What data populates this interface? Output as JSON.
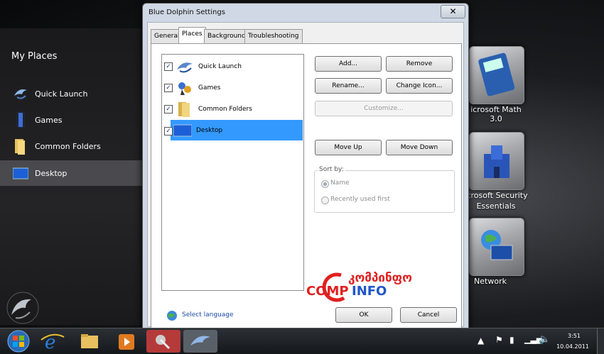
{
  "desktop": {
    "left_panel": {
      "title": "My Places",
      "items": [
        {
          "label": "Quick Launch",
          "icon": "dolphin-icon",
          "selected": false
        },
        {
          "label": "Games",
          "icon": "games-icon",
          "selected": false
        },
        {
          "label": "Common Folders",
          "icon": "folder-icon",
          "selected": false
        },
        {
          "label": "Desktop",
          "icon": "desktop-icon",
          "selected": true
        }
      ]
    },
    "icons": [
      {
        "label": "icrosoft Math 3.0",
        "icon": "calculator-icon"
      },
      {
        "label_line1": "icrosoft Security",
        "label_line2": "Essentials",
        "icon": "castle-icon"
      },
      {
        "label": "Network",
        "icon": "network-icon"
      }
    ]
  },
  "dialog": {
    "title": "Blue Dolphin Settings",
    "close_label": "✕",
    "tabs": [
      {
        "label": "General",
        "active": false
      },
      {
        "label": "Places",
        "active": true
      },
      {
        "label": "Background",
        "active": false
      },
      {
        "label": "Troubleshooting",
        "active": false
      }
    ],
    "places": [
      {
        "label": "Quick Launch",
        "checked": true,
        "selected": false
      },
      {
        "label": "Games",
        "checked": true,
        "selected": false
      },
      {
        "label": "Common Folders",
        "checked": true,
        "selected": false
      },
      {
        "label": "Desktop",
        "checked": true,
        "selected": true
      }
    ],
    "buttons": {
      "add": "Add...",
      "remove": "Remove",
      "rename": "Rename...",
      "change_icon": "Change Icon...",
      "customize": "Customize...",
      "move_up": "Move Up",
      "move_down": "Move Down",
      "ok": "OK",
      "cancel": "Cancel"
    },
    "sort": {
      "legend": "Sort by:",
      "option_name": "Name",
      "option_recent": "Recently used first",
      "selected": "Name"
    },
    "select_language": "Select language"
  },
  "watermark": {
    "line1": "კომპინფო",
    "comp": "COMP",
    "info": "INFO"
  },
  "taskbar": {
    "time": "3:51",
    "date": "10.04.2011"
  },
  "colors": {
    "selection_blue": "#3399ff",
    "watermark_red": "#e02020",
    "watermark_blue": "#1e56c8"
  }
}
